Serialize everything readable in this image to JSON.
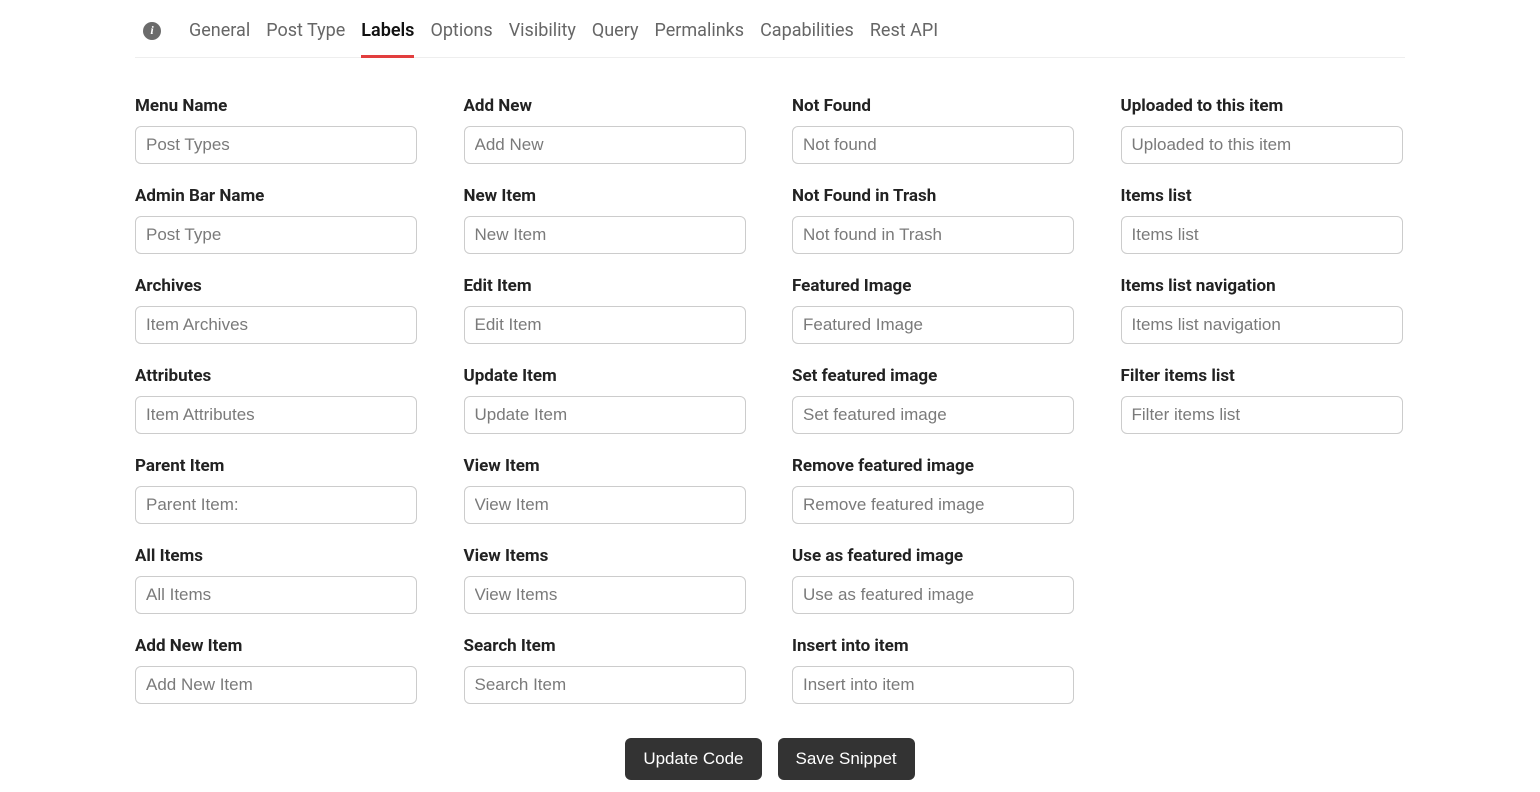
{
  "tabs": {
    "items": [
      "General",
      "Post Type",
      "Labels",
      "Options",
      "Visibility",
      "Query",
      "Permalinks",
      "Capabilities",
      "Rest API"
    ],
    "activeIndex": 2
  },
  "columns": [
    [
      {
        "label": "Menu Name",
        "placeholder": "Post Types"
      },
      {
        "label": "Admin Bar Name",
        "placeholder": "Post Type"
      },
      {
        "label": "Archives",
        "placeholder": "Item Archives"
      },
      {
        "label": "Attributes",
        "placeholder": "Item Attributes"
      },
      {
        "label": "Parent Item",
        "placeholder": "Parent Item:"
      },
      {
        "label": "All Items",
        "placeholder": "All Items"
      },
      {
        "label": "Add New Item",
        "placeholder": "Add New Item"
      }
    ],
    [
      {
        "label": "Add New",
        "placeholder": "Add New"
      },
      {
        "label": "New Item",
        "placeholder": "New Item"
      },
      {
        "label": "Edit Item",
        "placeholder": "Edit Item"
      },
      {
        "label": "Update Item",
        "placeholder": "Update Item"
      },
      {
        "label": "View Item",
        "placeholder": "View Item"
      },
      {
        "label": "View Items",
        "placeholder": "View Items"
      },
      {
        "label": "Search Item",
        "placeholder": "Search Item"
      }
    ],
    [
      {
        "label": "Not Found",
        "placeholder": "Not found"
      },
      {
        "label": "Not Found in Trash",
        "placeholder": "Not found in Trash"
      },
      {
        "label": "Featured Image",
        "placeholder": "Featured Image"
      },
      {
        "label": "Set featured image",
        "placeholder": "Set featured image"
      },
      {
        "label": "Remove featured image",
        "placeholder": "Remove featured image"
      },
      {
        "label": "Use as featured image",
        "placeholder": "Use as featured image"
      },
      {
        "label": "Insert into item",
        "placeholder": "Insert into item"
      }
    ],
    [
      {
        "label": "Uploaded to this item",
        "placeholder": "Uploaded to this item"
      },
      {
        "label": "Items list",
        "placeholder": "Items list"
      },
      {
        "label": "Items list navigation",
        "placeholder": "Items list navigation"
      },
      {
        "label": "Filter items list",
        "placeholder": "Filter items list"
      }
    ]
  ],
  "actions": {
    "update": "Update Code",
    "save": "Save Snippet"
  }
}
